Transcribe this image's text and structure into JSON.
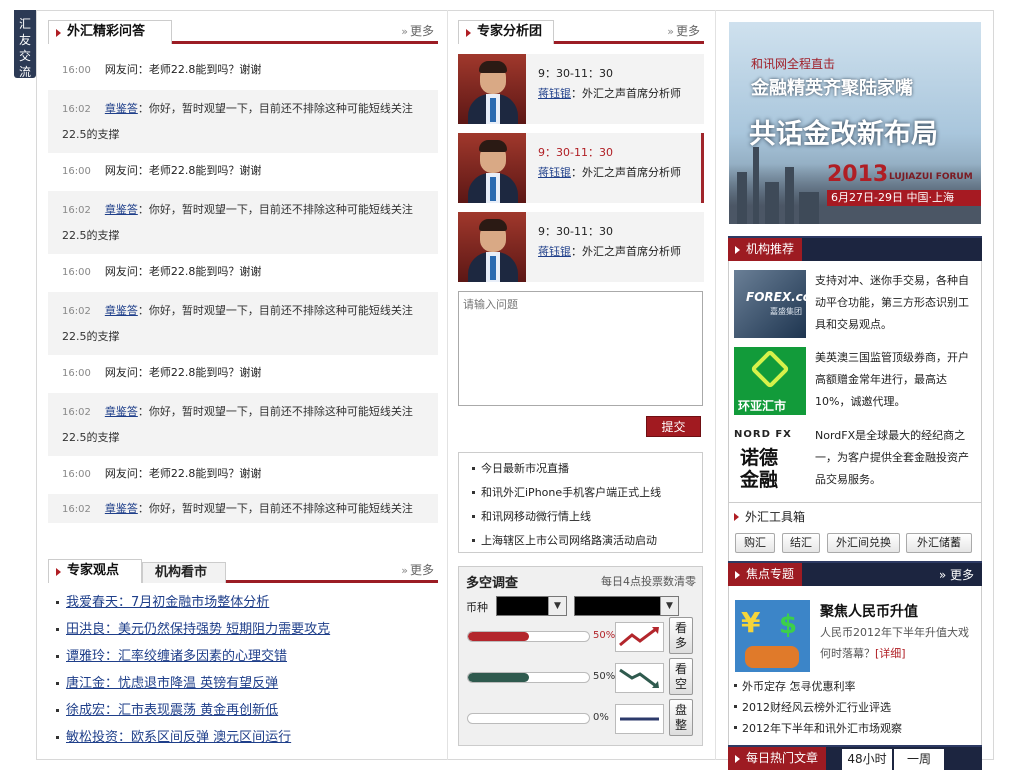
{
  "side_tab": "汇友交流",
  "qa": {
    "tab": "外汇精彩问答",
    "more": "更多",
    "items": [
      {
        "q_time": "16:00",
        "question": "网友问：老师22.8能到吗？谢谢",
        "a_time": "16:02",
        "answerer": "章鉴答",
        "answer": "：你好，暂时观望一下，目前还不排除这种可能短线关注22.5的支撑"
      },
      {
        "q_time": "16:00",
        "question": "网友问：老师22.8能到吗？谢谢",
        "a_time": "16:02",
        "answerer": "章鉴答",
        "answer": "：你好，暂时观望一下，目前还不排除这种可能短线关注22.5的支撑"
      },
      {
        "q_time": "16:00",
        "question": "网友问：老师22.8能到吗？谢谢",
        "a_time": "16:02",
        "answerer": "章鉴答",
        "answer": "：你好，暂时观望一下，目前还不排除这种可能短线关注22.5的支撑"
      },
      {
        "q_time": "16:00",
        "question": "网友问：老师22.8能到吗？谢谢",
        "a_time": "16:02",
        "answerer": "章鉴答",
        "answer": "：你好，暂时观望一下，目前还不排除这种可能短线关注22.5的支撑"
      },
      {
        "q_time": "16:00",
        "question": "网友问：老师22.8能到吗？谢谢",
        "a_time": "16:02",
        "answerer": "章鉴答",
        "answer": "：你好，暂时观望一下，目前还不排除这种可能短线关注"
      }
    ]
  },
  "views": {
    "tab_active": "专家观点",
    "tab_other": "机构看市",
    "more": "更多",
    "items": [
      "我爱春天：7月初金融市场整体分析",
      "田洪良：美元仍然保持强势 短期阻力需要攻克",
      "谭雅玲：汇率绞缠诸多因素的心理交错",
      "唐江金：忧虑退市降温 英镑有望反弹",
      "徐成宏：汇市表现震荡 黄金再创新低",
      "敏松投资：欧系区间反弹 澳元区间运行"
    ]
  },
  "experts": {
    "tab": "专家分析团",
    "more": "更多",
    "items": [
      {
        "time": "9：30-11：30",
        "name": "蒋钰锟",
        "title": "：外汇之声首席分析师"
      },
      {
        "time": "9：30-11：30",
        "name": "蒋钰锟",
        "title": "：外汇之声首席分析师"
      },
      {
        "time": "9：30-11：30",
        "name": "蒋钰锟",
        "title": "：外汇之声首席分析师"
      }
    ],
    "input_placeholder": "请输入问题",
    "submit": "提交"
  },
  "news": [
    "今日最新市况直播",
    "和讯外汇iPhone手机客户端正式上线",
    "和讯网移动微行情上线",
    "上海辖区上市公司网络路演活动启动"
  ],
  "poll": {
    "title": "多空调查",
    "note": "每日4点投票数清零",
    "currency_label": "币种",
    "rows": [
      {
        "pct": "50%",
        "fill": 0.5,
        "color": "#b3262c",
        "vote": "看多"
      },
      {
        "pct": "50%",
        "fill": 0.5,
        "color": "#2f5a4e",
        "vote": "看空"
      },
      {
        "pct": "0%",
        "fill": 0.0,
        "color": "#2c3a6b",
        "vote": "盘整"
      }
    ]
  },
  "banner": {
    "line1": "和讯网全程直击",
    "line2": "金融精英齐聚陆家嘴",
    "line3": "共话金改新布局",
    "year": "2013",
    "forum": "LUJIAZUI FORUM",
    "dates": "6月27日-29日 中国·上海"
  },
  "orgs": {
    "title": "机构推荐",
    "items": [
      {
        "logo": "FOREX.com",
        "logo_sub": "嘉盛集团",
        "text": "支持对冲、迷你手交易，各种自动平仓功能，第三方形态识别工具和交易观点。"
      },
      {
        "logo": "环亚汇市",
        "text": "美英澳三国监管顶级券商，开户高额赠金常年进行，最高达10%，诚邀代理。"
      },
      {
        "logo": "NORD FX",
        "logo_sub": "诺德金融",
        "text": "NordFX是全球最大的经纪商之一，为客户提供全套金融投资产品交易服务。"
      }
    ]
  },
  "tools": {
    "title": "外汇工具箱",
    "buttons": [
      "购汇",
      "结汇",
      "外汇间兑换",
      "外汇储蓄"
    ]
  },
  "focus": {
    "title": "焦点专题",
    "more": "更多",
    "headline": "聚焦人民币升值",
    "summary": "人民币2012年下半年升值大戏何时落幕？",
    "detail": "[详细]",
    "items": [
      "外币定存 怎寻优惠利率",
      "2012财经风云榜外汇行业评选",
      "2012年下半年和讯外汇市场观察"
    ]
  },
  "hot": {
    "title": "每日热门文章",
    "tabs": [
      "48小时",
      "一周"
    ]
  },
  "colors": {
    "accent": "#9d1b22",
    "navy": "#1c2540",
    "link": "#1f3f8a"
  }
}
